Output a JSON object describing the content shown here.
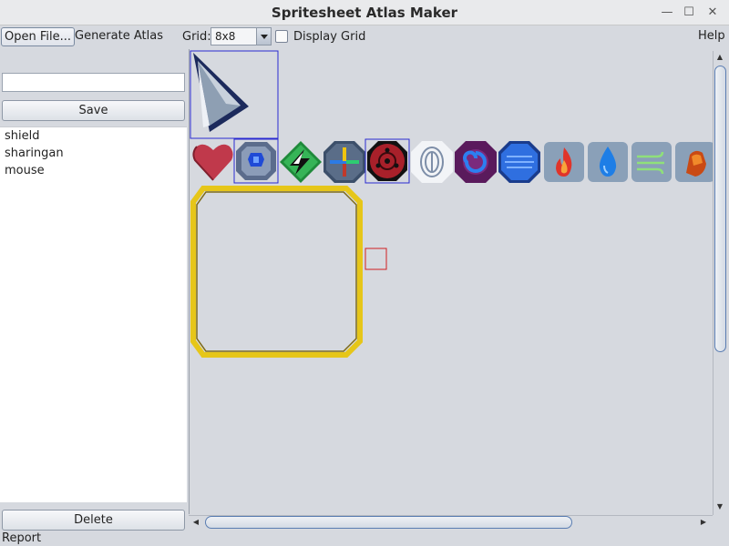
{
  "window": {
    "title": "Spritesheet Atlas Maker",
    "controls": {
      "minimize": "—",
      "maximize": "☐",
      "close": "✕"
    }
  },
  "toolbar": {
    "open_file_label": "Open File...",
    "generate_atlas_label": "Generate Atlas",
    "grid_label": "Grid:",
    "grid_value": "8x8",
    "display_grid_label": "Display Grid",
    "display_grid_checked": false,
    "help_label": "Help"
  },
  "sidebar": {
    "name_input": {
      "value": "",
      "placeholder": ""
    },
    "save_label": "Save",
    "items": [
      {
        "label": "shield"
      },
      {
        "label": "sharingan"
      },
      {
        "label": "mouse"
      }
    ],
    "delete_label": "Delete"
  },
  "canvas": {
    "sprites": [
      {
        "name": "cursor-arrow",
        "selected": true
      },
      {
        "name": "heart",
        "selected": false
      },
      {
        "name": "shield",
        "selected": true
      },
      {
        "name": "lightning-badge",
        "selected": false
      },
      {
        "name": "cross-badge",
        "selected": false
      },
      {
        "name": "sharingan",
        "selected": true
      },
      {
        "name": "fingerprint-badge",
        "selected": false
      },
      {
        "name": "swirl-badge",
        "selected": false
      },
      {
        "name": "blue-orb-badge",
        "selected": false
      },
      {
        "name": "fire-tile",
        "selected": false
      },
      {
        "name": "water-tile",
        "selected": false
      },
      {
        "name": "wind-tile",
        "selected": false
      },
      {
        "name": "earth-tile",
        "selected": false
      },
      {
        "name": "yellow-frame",
        "selected": false
      }
    ]
  },
  "status_bar": {
    "label": "Report"
  },
  "colors": {
    "selection": "#2a2ad0",
    "marker": "#d02020",
    "frame": "#e6c619"
  }
}
